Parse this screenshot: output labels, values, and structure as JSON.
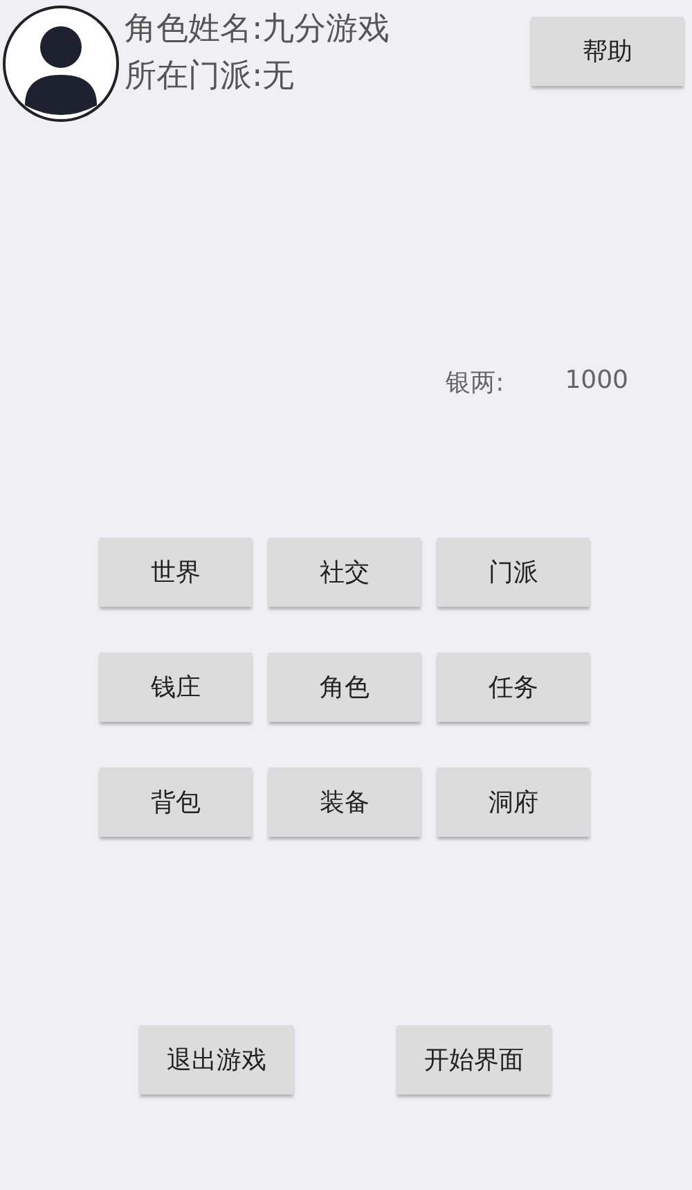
{
  "profile": {
    "name_line": "角色姓名:九分游戏",
    "sect_line": "所在门派:无"
  },
  "help_button": "帮助",
  "silver": {
    "label": "银两:",
    "value": "1000"
  },
  "menu_buttons": [
    "世界",
    "社交",
    "门派",
    "钱庄",
    "角色",
    "任务",
    "背包",
    "装备",
    "洞府"
  ],
  "bottom_buttons": [
    "退出游戏",
    "开始界面"
  ]
}
